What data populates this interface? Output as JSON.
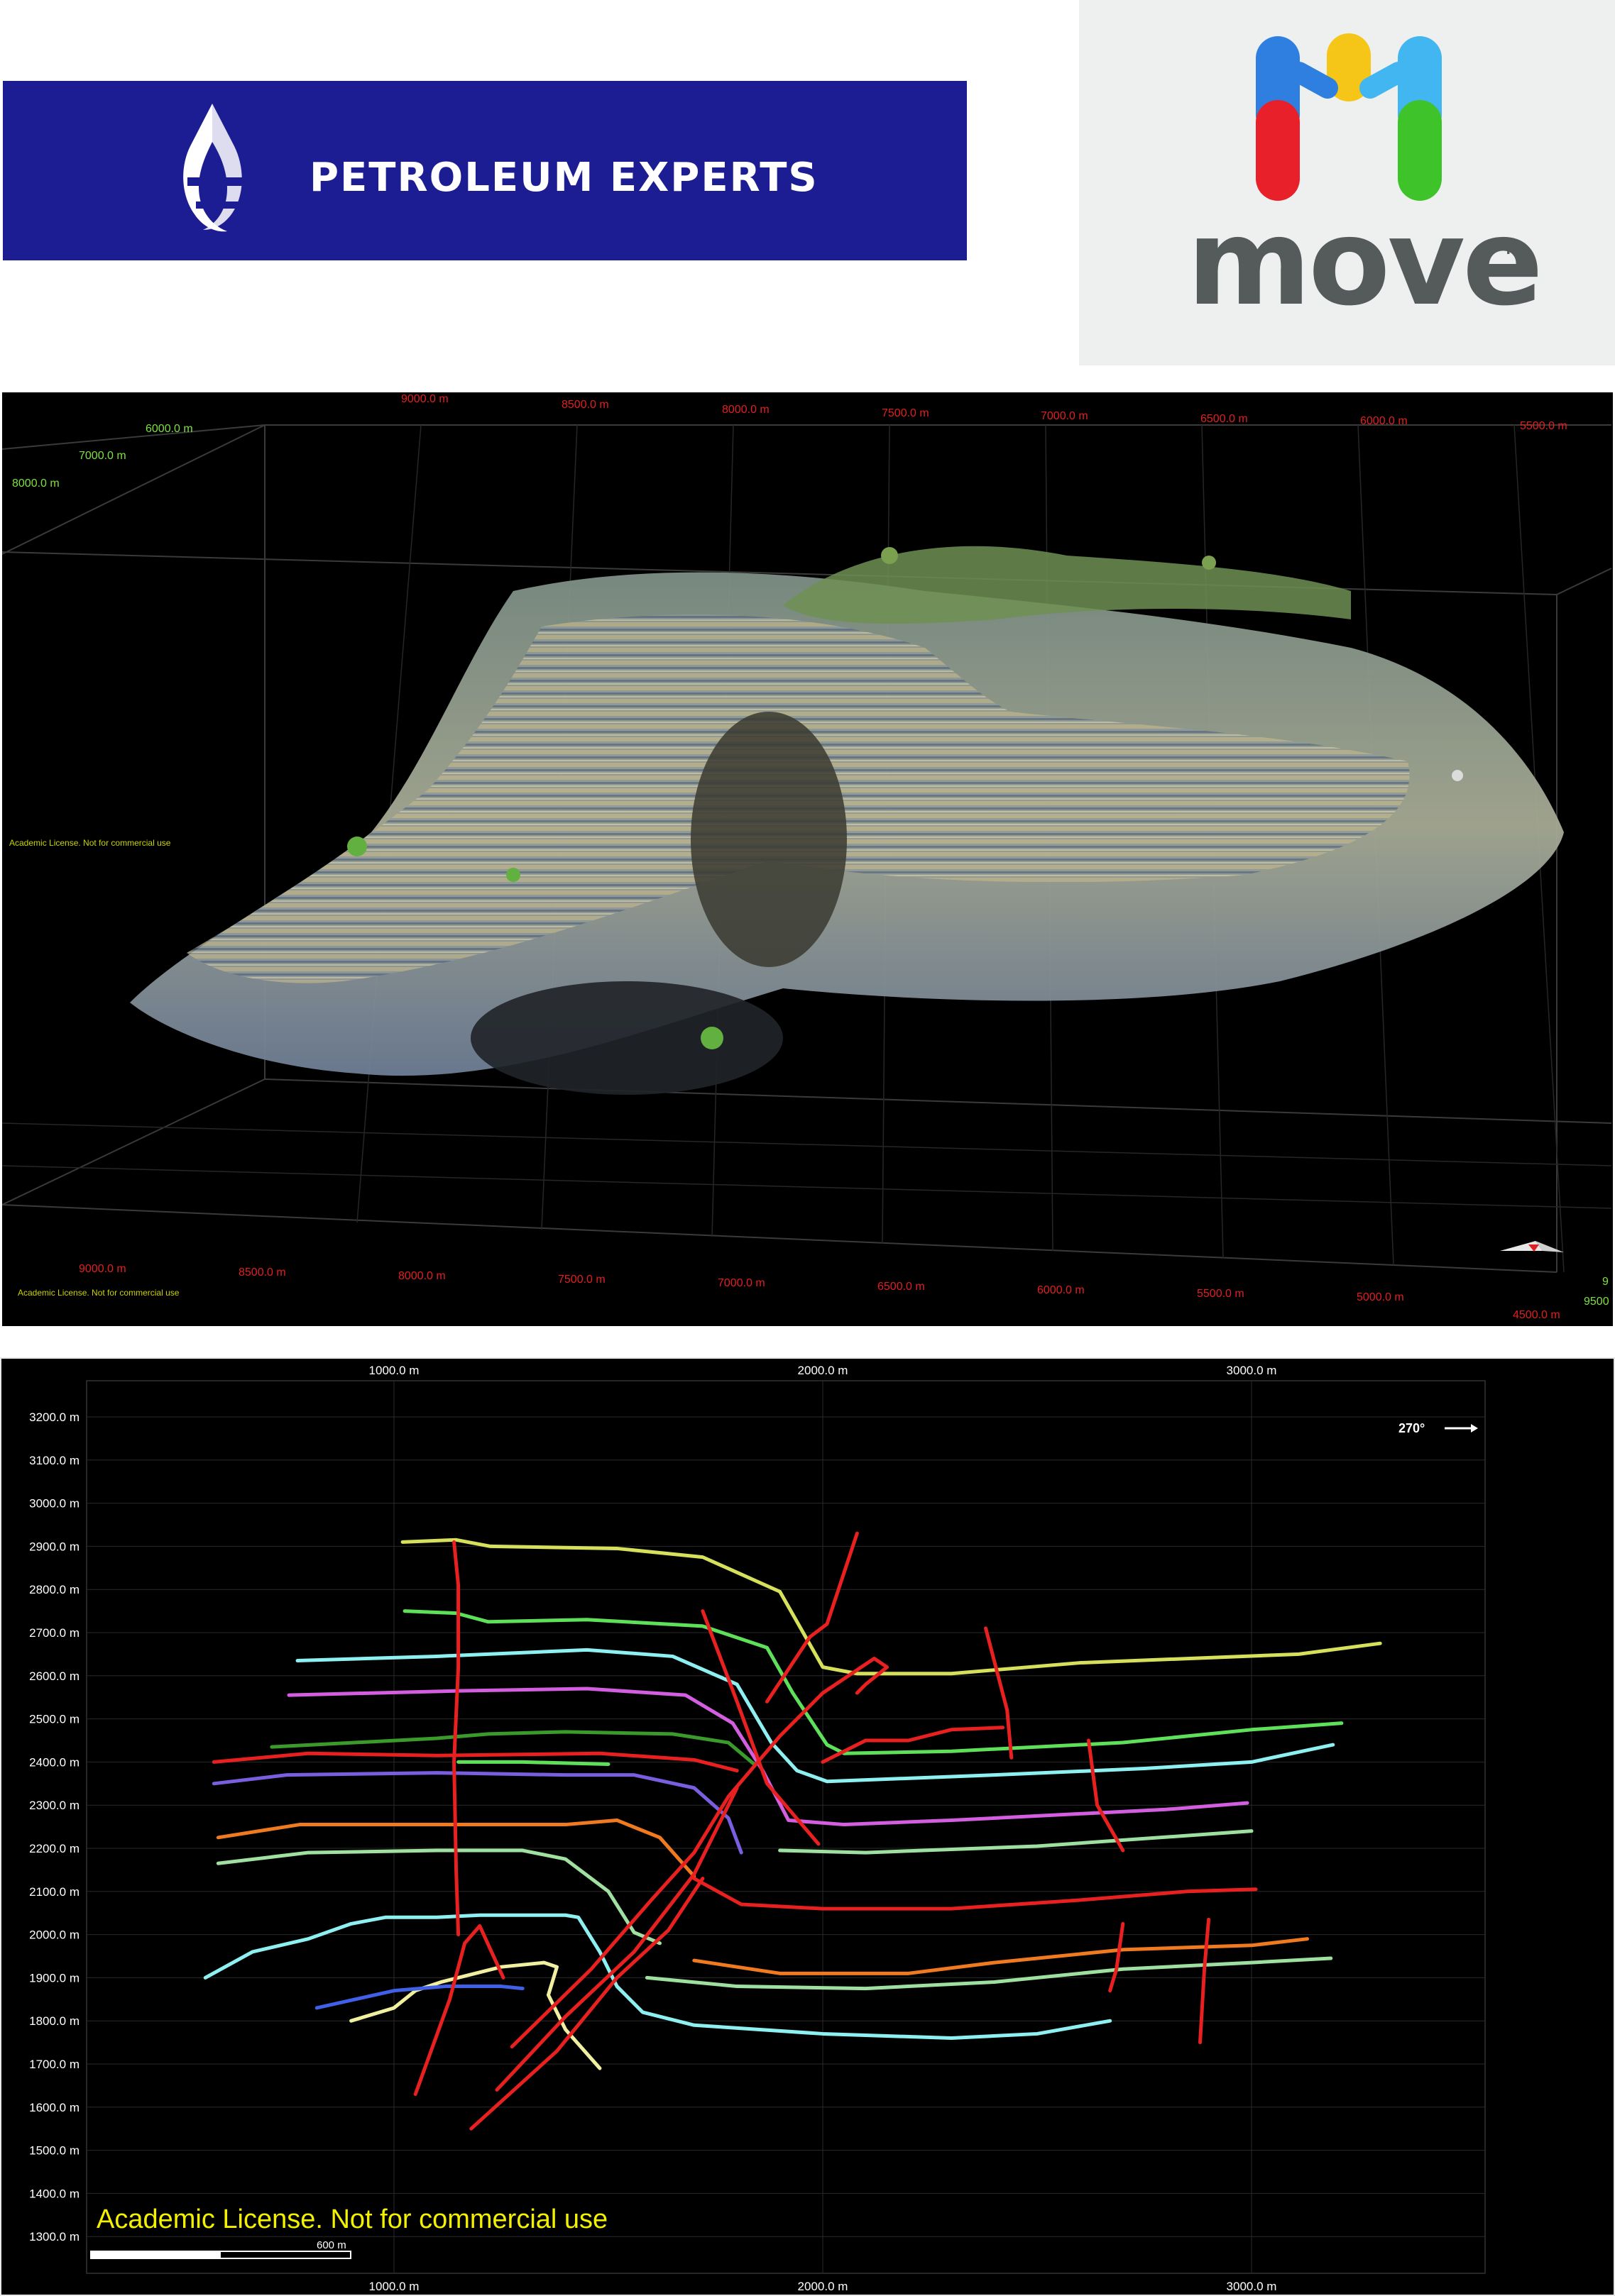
{
  "logos": {
    "pe_text": "PETROLEUM EXPERTS",
    "pe_colors": {
      "background": "#1d1d93",
      "text": "#ffffff"
    },
    "move_text": "move",
    "move_tm": "TM",
    "move_colors": {
      "blue": "#2f7fe0",
      "yellow": "#f5c518",
      "cyan": "#42b6f0",
      "red": "#e8202a",
      "green": "#3ec42a",
      "text": "#555a5a"
    }
  },
  "view3d": {
    "license_text": "Academic License. Not for commercial use",
    "top_x_labels": [
      "9000.0 m",
      "8500.0 m",
      "8000.0 m",
      "7500.0 m",
      "7000.0 m",
      "6500.0 m",
      "6000.0 m",
      "5500.0 m"
    ],
    "bottom_x_labels": [
      "9000.0 m",
      "8500.0 m",
      "8000.0 m",
      "7500.0 m",
      "7000.0 m",
      "6500.0 m",
      "6000.0 m",
      "5500.0 m",
      "5000.0 m",
      "4500.0 m"
    ],
    "left_y_labels": [
      "6000.0 m",
      "7000.0 m",
      "8000.0 m"
    ],
    "right_y_labels": [
      "9",
      "9500"
    ],
    "colors": {
      "x_labels": "#e02020",
      "y_labels": "#7ee040",
      "grid": "#3a3a3a",
      "license": "#c9d400"
    }
  },
  "map2d": {
    "license_text": "Academic License. Not for commercial use",
    "direction_label": "270°",
    "scale_label": "600 m",
    "x_labels": [
      "1000.0 m",
      "2000.0 m",
      "3000.0 m"
    ],
    "y_labels": [
      "3200.0 m",
      "3100.0 m",
      "3000.0 m",
      "2900.0 m",
      "2800.0 m",
      "2700.0 m",
      "2600.0 m",
      "2500.0 m",
      "2400.0 m",
      "2300.0 m",
      "2200.0 m",
      "2100.0 m",
      "2000.0 m",
      "1900.0 m",
      "1800.0 m",
      "1700.0 m",
      "1600.0 m",
      "1500.0 m",
      "1400.0 m",
      "1300.0 m"
    ],
    "x_values": [
      1000,
      2000,
      3000
    ],
    "y_values": [
      3200,
      3100,
      3000,
      2900,
      2800,
      2700,
      2600,
      2500,
      2400,
      2300,
      2200,
      2100,
      2000,
      1900,
      1800,
      1700,
      1600,
      1500,
      1400,
      1300
    ],
    "horizons": [
      {
        "color": "#d6e05a",
        "points": [
          [
            20,
            2910
          ],
          [
            145,
            2915
          ],
          [
            225,
            2900
          ],
          [
            520,
            2895
          ],
          [
            720,
            2875
          ],
          [
            900,
            2795
          ],
          [
            1000,
            2620
          ],
          [
            1080,
            2605
          ],
          [
            1300,
            2605
          ],
          [
            1600,
            2630
          ],
          [
            2110,
            2650
          ],
          [
            2300,
            2675
          ]
        ]
      },
      {
        "color": "#5ee05a",
        "points": [
          [
            25,
            2750
          ],
          [
            145,
            2745
          ],
          [
            220,
            2725
          ],
          [
            450,
            2730
          ],
          [
            720,
            2715
          ],
          [
            870,
            2665
          ],
          [
            930,
            2560
          ],
          [
            1010,
            2440
          ],
          [
            1050,
            2420
          ],
          [
            1300,
            2425
          ],
          [
            1700,
            2445
          ],
          [
            2000,
            2475
          ],
          [
            2210,
            2490
          ]
        ]
      },
      {
        "color": "#8ef0f0",
        "points": [
          [
            -225,
            2635
          ],
          [
            100,
            2645
          ],
          [
            450,
            2660
          ],
          [
            650,
            2645
          ],
          [
            800,
            2580
          ],
          [
            880,
            2445
          ],
          [
            940,
            2380
          ],
          [
            1010,
            2355
          ],
          [
            1400,
            2370
          ],
          [
            1750,
            2385
          ],
          [
            2000,
            2400
          ],
          [
            2190,
            2440
          ]
        ]
      },
      {
        "color": "#d35ee0",
        "points": [
          [
            -245,
            2555
          ],
          [
            150,
            2565
          ],
          [
            450,
            2570
          ],
          [
            680,
            2555
          ],
          [
            790,
            2490
          ],
          [
            860,
            2380
          ],
          [
            920,
            2265
          ],
          [
            1050,
            2255
          ],
          [
            1300,
            2265
          ],
          [
            1800,
            2290
          ],
          [
            1990,
            2305
          ]
        ]
      },
      {
        "color": "#3a9a2a",
        "points": [
          [
            -285,
            2435
          ],
          [
            100,
            2455
          ],
          [
            220,
            2465
          ],
          [
            400,
            2470
          ],
          [
            650,
            2465
          ],
          [
            780,
            2445
          ],
          [
            840,
            2395
          ]
        ]
      },
      {
        "color": "#5ee05a",
        "points": [
          [
            150,
            2400
          ],
          [
            300,
            2400
          ],
          [
            500,
            2395
          ]
        ]
      },
      {
        "color": "#e82020",
        "points": [
          [
            -420,
            2400
          ],
          [
            -200,
            2420
          ],
          [
            100,
            2415
          ],
          [
            480,
            2420
          ],
          [
            700,
            2405
          ],
          [
            800,
            2380
          ]
        ]
      },
      {
        "color": "#7a5ee0",
        "points": [
          [
            -420,
            2350
          ],
          [
            -250,
            2370
          ],
          [
            100,
            2375
          ],
          [
            400,
            2370
          ],
          [
            560,
            2370
          ],
          [
            700,
            2340
          ],
          [
            780,
            2270
          ],
          [
            810,
            2190
          ]
        ]
      },
      {
        "color": "#9ee0a0",
        "points": [
          [
            900,
            2195
          ],
          [
            1100,
            2190
          ],
          [
            1500,
            2205
          ],
          [
            2000,
            2240
          ]
        ]
      },
      {
        "color": "#f07a20",
        "points": [
          [
            -410,
            2225
          ],
          [
            -220,
            2255
          ],
          [
            100,
            2255
          ],
          [
            400,
            2255
          ],
          [
            520,
            2265
          ],
          [
            620,
            2225
          ],
          [
            700,
            2135
          ]
        ]
      },
      {
        "color": "#e82020",
        "points": [
          [
            700,
            2130
          ],
          [
            810,
            2070
          ],
          [
            1000,
            2060
          ],
          [
            1300,
            2060
          ],
          [
            1600,
            2080
          ],
          [
            1850,
            2100
          ],
          [
            2010,
            2105
          ]
        ]
      },
      {
        "color": "#a0e0a0",
        "points": [
          [
            -410,
            2165
          ],
          [
            -200,
            2190
          ],
          [
            100,
            2195
          ],
          [
            300,
            2195
          ],
          [
            400,
            2175
          ],
          [
            500,
            2100
          ],
          [
            560,
            2005
          ],
          [
            620,
            1980
          ]
        ]
      },
      {
        "color": "#8ef0f0",
        "points": [
          [
            -440,
            1900
          ],
          [
            -330,
            1960
          ],
          [
            -200,
            1990
          ],
          [
            -100,
            2025
          ],
          [
            -20,
            2040
          ],
          [
            100,
            2040
          ],
          [
            200,
            2045
          ],
          [
            400,
            2045
          ],
          [
            430,
            2040
          ],
          [
            480,
            1960
          ],
          [
            520,
            1880
          ],
          [
            580,
            1820
          ],
          [
            700,
            1790
          ],
          [
            1000,
            1770
          ],
          [
            1300,
            1760
          ],
          [
            1500,
            1770
          ],
          [
            1670,
            1800
          ]
        ]
      },
      {
        "color": "#f07a20",
        "points": [
          [
            700,
            1940
          ],
          [
            900,
            1910
          ],
          [
            1200,
            1910
          ],
          [
            1400,
            1935
          ],
          [
            1700,
            1965
          ],
          [
            2000,
            1975
          ],
          [
            2130,
            1990
          ]
        ]
      },
      {
        "color": "#9ee0a0",
        "points": [
          [
            590,
            1900
          ],
          [
            800,
            1880
          ],
          [
            1100,
            1875
          ],
          [
            1400,
            1890
          ],
          [
            1700,
            1920
          ],
          [
            2000,
            1935
          ],
          [
            2185,
            1945
          ]
        ]
      },
      {
        "color": "#f0f0a0",
        "points": [
          [
            -100,
            1800
          ],
          [
            0,
            1830
          ],
          [
            50,
            1870
          ],
          [
            110,
            1890
          ],
          [
            170,
            1905
          ],
          [
            250,
            1925
          ],
          [
            350,
            1935
          ],
          [
            380,
            1925
          ],
          [
            360,
            1860
          ],
          [
            400,
            1780
          ],
          [
            480,
            1690
          ]
        ]
      },
      {
        "color": "#4060e8",
        "points": [
          [
            -180,
            1830
          ],
          [
            0,
            1870
          ],
          [
            120,
            1880
          ],
          [
            250,
            1880
          ],
          [
            300,
            1875
          ]
        ]
      }
    ],
    "faults": [
      {
        "color": "#e82020",
        "points": [
          [
            140,
            2910
          ],
          [
            150,
            2810
          ],
          [
            150,
            2620
          ],
          [
            140,
            2400
          ],
          [
            145,
            2150
          ],
          [
            150,
            2000
          ]
        ]
      },
      {
        "color": "#e82020",
        "points": [
          [
            720,
            2750
          ],
          [
            800,
            2540
          ],
          [
            870,
            2350
          ],
          [
            990,
            2210
          ]
        ]
      },
      {
        "color": "#e82020",
        "points": [
          [
            50,
            1630
          ],
          [
            130,
            1850
          ],
          [
            165,
            1980
          ],
          [
            200,
            2020
          ],
          [
            255,
            1900
          ]
        ]
      },
      {
        "color": "#e82020",
        "points": [
          [
            180,
            1550
          ],
          [
            380,
            1730
          ],
          [
            520,
            1900
          ],
          [
            640,
            2010
          ],
          [
            720,
            2130
          ]
        ]
      },
      {
        "color": "#e82020",
        "points": [
          [
            240,
            1640
          ],
          [
            400,
            1810
          ],
          [
            560,
            1960
          ],
          [
            700,
            2140
          ],
          [
            800,
            2340
          ]
        ]
      },
      {
        "color": "#e82020",
        "points": [
          [
            275,
            1740
          ],
          [
            460,
            1920
          ],
          [
            600,
            2080
          ],
          [
            700,
            2190
          ],
          [
            780,
            2320
          ],
          [
            900,
            2460
          ],
          [
            1000,
            2560
          ],
          [
            1120,
            2640
          ],
          [
            1150,
            2620
          ],
          [
            1100,
            2580
          ],
          [
            1080,
            2560
          ]
        ]
      },
      {
        "color": "#e82020",
        "points": [
          [
            870,
            2540
          ],
          [
            970,
            2690
          ],
          [
            1010,
            2720
          ],
          [
            1080,
            2930
          ]
        ]
      },
      {
        "color": "#e82020",
        "points": [
          [
            1000,
            2400
          ],
          [
            1100,
            2450
          ],
          [
            1200,
            2450
          ],
          [
            1300,
            2475
          ],
          [
            1420,
            2480
          ]
        ]
      },
      {
        "color": "#e82020",
        "points": [
          [
            1380,
            2710
          ],
          [
            1430,
            2520
          ],
          [
            1440,
            2410
          ]
        ]
      },
      {
        "color": "#e82020",
        "points": [
          [
            1620,
            2450
          ],
          [
            1640,
            2300
          ],
          [
            1700,
            2195
          ]
        ]
      },
      {
        "color": "#e82020",
        "points": [
          [
            1700,
            2025
          ],
          [
            1685,
            1920
          ],
          [
            1670,
            1870
          ]
        ]
      },
      {
        "color": "#e82020",
        "points": [
          [
            1880,
            1750
          ],
          [
            1890,
            1920
          ],
          [
            1900,
            2035
          ]
        ]
      }
    ],
    "fault_color": "#e82020",
    "colors": {
      "axis_text": "#ffffff",
      "grid": "#2a2a2a",
      "license": "#f3f000",
      "frame": "#e8e8e8"
    }
  }
}
